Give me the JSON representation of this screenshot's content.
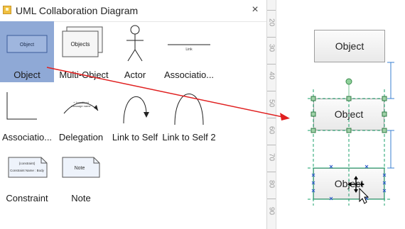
{
  "panel": {
    "title": "UML Collaboration Diagram",
    "close_glyph": "×",
    "header_icon": "library-icon"
  },
  "shapes": [
    {
      "label": "Object",
      "thumb_text": "Object",
      "selected": true
    },
    {
      "label": "Multi-Object",
      "thumb_text": "Objects"
    },
    {
      "label": "Actor"
    },
    {
      "label": "Associatio...",
      "thumb_text": "Link"
    },
    {
      "label": "Associatio..."
    },
    {
      "label": "Delegation",
      "thumb_text": [
        "+ [condition]",
        "message name"
      ]
    },
    {
      "label": "Link to Self"
    },
    {
      "label": "Link to Self 2"
    },
    {
      "label": "Constraint",
      "thumb_text": [
        "{constraint}",
        "Constraint Name : Body"
      ]
    },
    {
      "label": "Note",
      "thumb_text": "Note"
    }
  ],
  "ruler": {
    "numbers": [
      "20",
      "30",
      "40",
      "50",
      "60",
      "70",
      "80",
      "90"
    ]
  },
  "canvas": {
    "objects": [
      {
        "label": "Object"
      },
      {
        "label": "Object"
      },
      {
        "label": "Object"
      }
    ]
  },
  "colors": {
    "selection": "#8fa9d6",
    "drag_arrow": "#e02020",
    "guide": "#1aa06b",
    "handle": "#7cc59a",
    "dimension": "#3a7fd0",
    "snap_x": "#2855c8"
  }
}
